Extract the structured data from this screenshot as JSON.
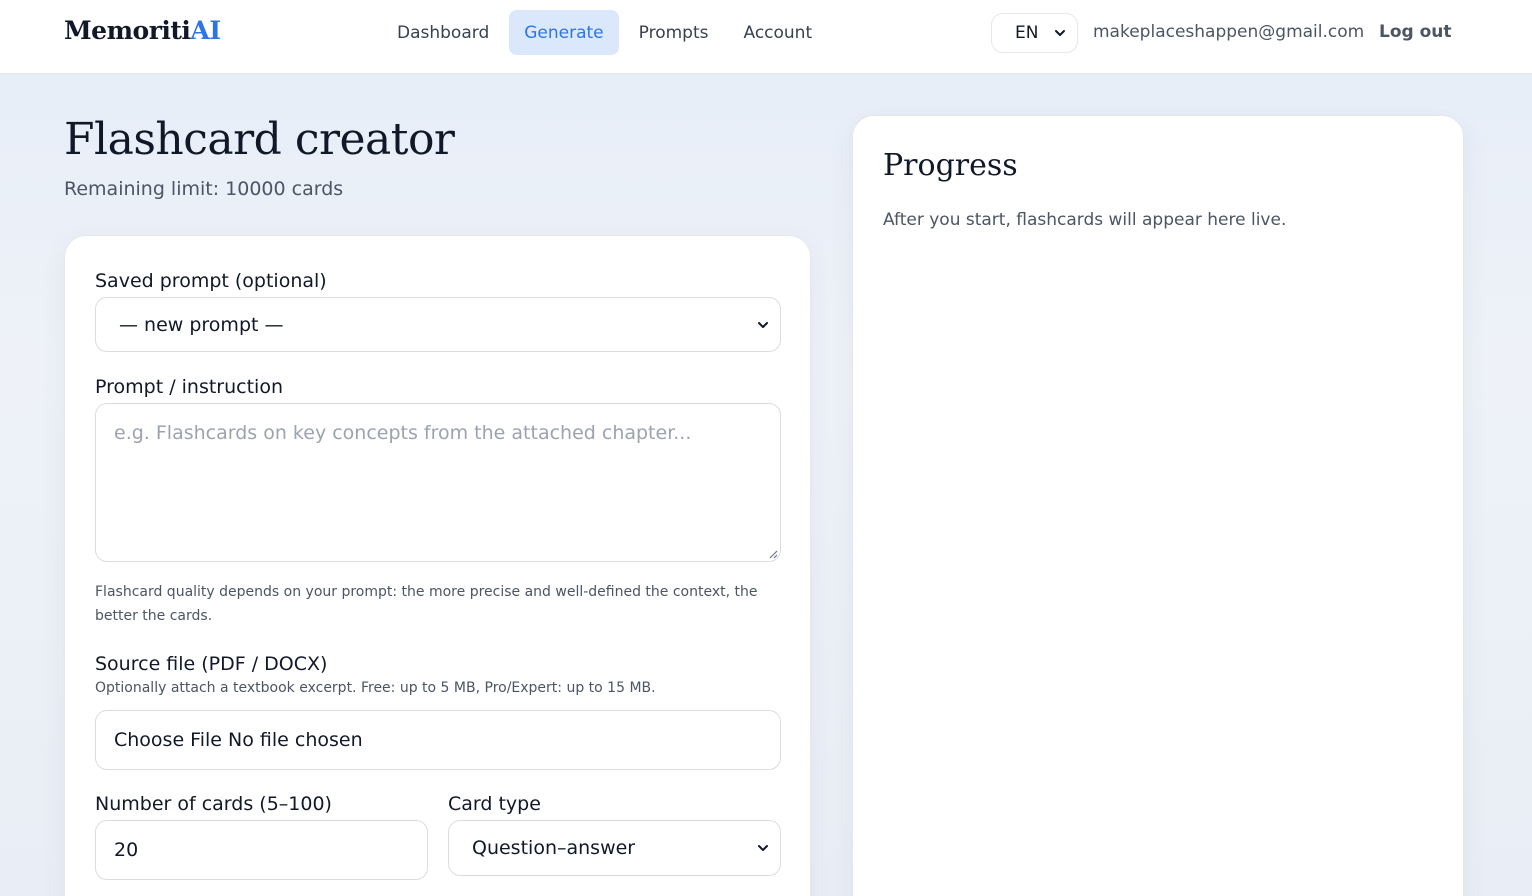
{
  "brand": {
    "name": "Memoriti",
    "suffix": "AI",
    "accent_color": "#2f74e6"
  },
  "nav": {
    "items": [
      {
        "label": "Dashboard",
        "active": false
      },
      {
        "label": "Generate",
        "active": true
      },
      {
        "label": "Prompts",
        "active": false
      },
      {
        "label": "Account",
        "active": false
      }
    ]
  },
  "header": {
    "language": "EN",
    "email": "makeplaceshappen@gmail.com",
    "logout_label": "Log out"
  },
  "page": {
    "title": "Flashcard creator",
    "remaining_limit": "Remaining limit: 10000 cards"
  },
  "form": {
    "saved_prompt_label": "Saved prompt (optional)",
    "saved_prompt_value": "— new prompt —",
    "prompt_label": "Prompt / instruction",
    "prompt_placeholder": "e.g. Flashcards on key concepts from the attached chapter...",
    "prompt_hint": "Flashcard quality depends on your prompt: the more precise and well-defined the context, the better the cards.",
    "source_label": "Source file (PDF / DOCX)",
    "source_hint": "Optionally attach a textbook excerpt. Free: up to 5 MB, Pro/Expert: up to 15 MB.",
    "file_button": "Choose File",
    "file_status": "No file chosen",
    "count_label": "Number of cards (5–100)",
    "count_value": "20",
    "type_label": "Card type",
    "type_value": "Question–answer"
  },
  "progress": {
    "title": "Progress",
    "text": "After you start, flashcards will appear here live."
  }
}
